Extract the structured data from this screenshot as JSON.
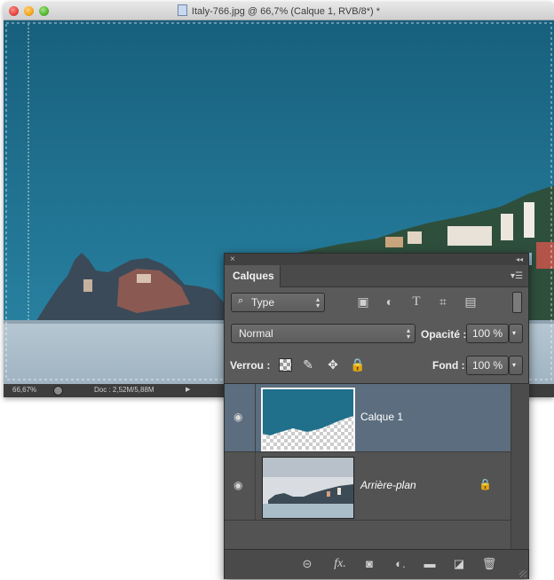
{
  "window": {
    "title": "Italy-766.jpg @ 66,7% (Calque 1, RVB/8*) *"
  },
  "statusbar": {
    "zoom": "66,67%",
    "doc_size": "Doc : 2,52M/5,88M"
  },
  "panel": {
    "tab_label": "Calques",
    "filter": {
      "label": "Type",
      "icons": [
        "image-filter-icon",
        "adjustment-filter-icon",
        "type-filter-icon",
        "shape-filter-icon",
        "smart-object-filter-icon"
      ]
    },
    "blend_mode": "Normal",
    "opacity_label": "Opacité :",
    "opacity_value": "100 %",
    "lock_label": "Verrou :",
    "fill_label": "Fond :",
    "fill_value": "100 %",
    "layers": [
      {
        "name": "Calque 1",
        "visible": true,
        "selected": true
      },
      {
        "name": "Arrière-plan",
        "visible": true,
        "selected": false,
        "locked": true
      }
    ],
    "bottom_icons": [
      "link-icon",
      "fx-icon",
      "mask-icon",
      "adjustment-icon",
      "group-folder-icon",
      "new-layer-icon",
      "trash-icon"
    ]
  },
  "colors": {
    "sky": "#1f6e8a",
    "panel_bg": "#5a5a5a",
    "selected_row": "#5b6d7e"
  }
}
